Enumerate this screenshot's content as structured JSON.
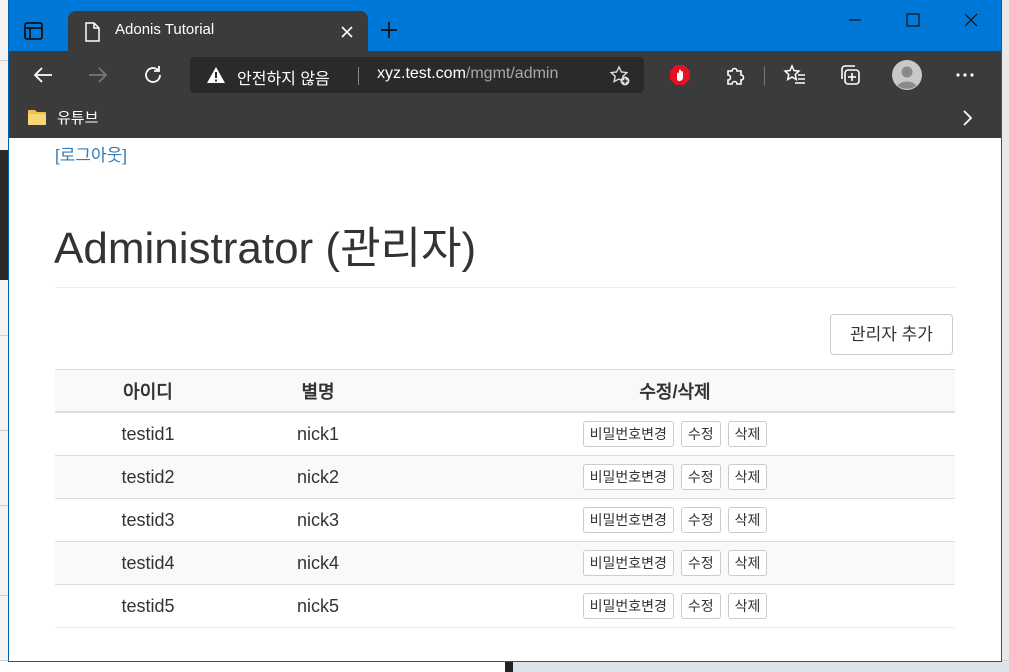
{
  "browser": {
    "tab_title": "Adonis Tutorial",
    "security_label": "안전하지 않음",
    "url_host": "xyz.test.com",
    "url_path": "/mgmt/admin",
    "bookmark_folder": "유튜브",
    "accent_color": "#0078d7",
    "chrome_color": "#3b3b3b"
  },
  "page": {
    "logout_link": "[로그아웃]",
    "title": "Administrator (관리자)",
    "add_button": "관리자 추가",
    "link_color": "#337ab7"
  },
  "table": {
    "headers": [
      "아이디",
      "별명",
      "수정/삭제"
    ],
    "rows": [
      {
        "id": "testid1",
        "nick": "nick1"
      },
      {
        "id": "testid2",
        "nick": "nick2"
      },
      {
        "id": "testid3",
        "nick": "nick3"
      },
      {
        "id": "testid4",
        "nick": "nick4"
      },
      {
        "id": "testid5",
        "nick": "nick5"
      }
    ],
    "actions": {
      "change_password": "비밀번호변경",
      "edit": "수정",
      "delete": "삭제"
    }
  },
  "icons": [
    "tab-actions-icon",
    "page-icon",
    "close-icon",
    "new-tab-icon",
    "minimize-icon",
    "maximize-icon",
    "window-close-icon",
    "back-icon",
    "forward-icon",
    "refresh-icon",
    "warning-icon",
    "add-favorite-icon",
    "adblock-icon",
    "extensions-icon",
    "favorites-icon",
    "collections-icon",
    "profile-icon",
    "more-icon",
    "folder-icon",
    "chevron-right-icon"
  ]
}
